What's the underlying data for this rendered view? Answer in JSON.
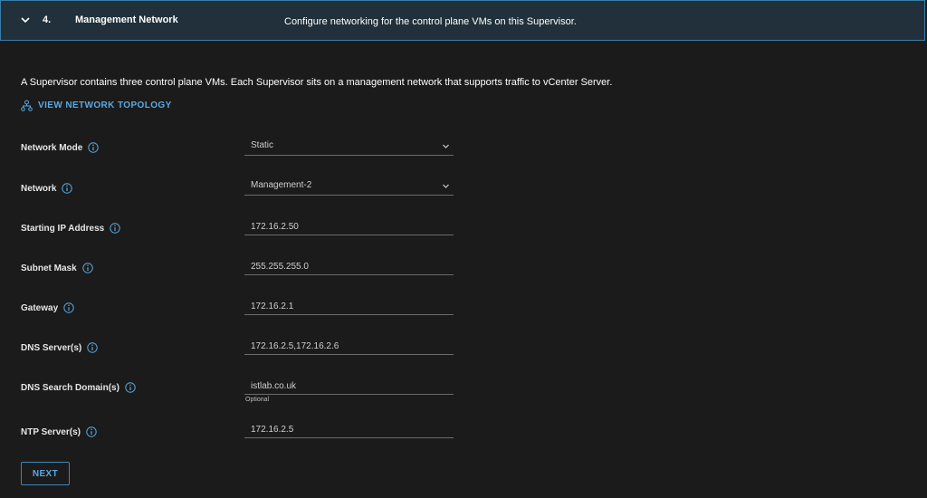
{
  "header": {
    "step": "4.",
    "title": "Management Network",
    "description": "Configure networking for the control plane VMs on this Supervisor."
  },
  "intro": "A Supervisor contains three control plane VMs. Each Supervisor sits on a management network that supports traffic to vCenter Server.",
  "topology_link": "VIEW NETWORK TOPOLOGY",
  "fields": {
    "network_mode": {
      "label": "Network Mode",
      "value": "Static"
    },
    "network": {
      "label": "Network",
      "value": "Management-2"
    },
    "starting_ip": {
      "label": "Starting IP Address",
      "value": "172.16.2.50"
    },
    "subnet_mask": {
      "label": "Subnet Mask",
      "value": "255.255.255.0"
    },
    "gateway": {
      "label": "Gateway",
      "value": "172.16.2.1"
    },
    "dns_servers": {
      "label": "DNS Server(s)",
      "value": "172.16.2.5,172.16.2.6"
    },
    "dns_search": {
      "label": "DNS Search Domain(s)",
      "value": "istlab.co.uk",
      "note": "Optional"
    },
    "ntp_servers": {
      "label": "NTP Server(s)",
      "value": "172.16.2.5"
    }
  },
  "next_label": "NEXT",
  "icons": {
    "header_toggle": "chevron-down-icon",
    "topology": "network-topology-icon",
    "info": "info-icon",
    "dropdown": "chevron-down-icon"
  },
  "colors": {
    "background": "#1b1b1b",
    "header_background": "#21303a",
    "header_border": "#3a7fa8",
    "link": "#5aa9e0",
    "info_icon": "#5aa9e0"
  }
}
